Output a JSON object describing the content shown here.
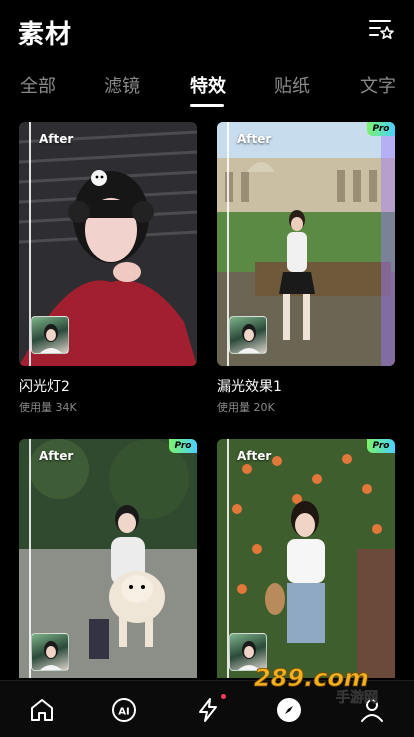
{
  "header": {
    "title": "素材"
  },
  "tabs": [
    {
      "label": "全部"
    },
    {
      "label": "滤镜"
    },
    {
      "label": "特效"
    },
    {
      "label": "贴纸"
    },
    {
      "label": "文字"
    }
  ],
  "active_tab_index": 2,
  "badges": {
    "after": "After",
    "pro": "Pro"
  },
  "cards": [
    {
      "name": "闪光灯2",
      "usage": "使用量 34K",
      "pro": false
    },
    {
      "name": "漏光效果1",
      "usage": "使用量 20K",
      "pro": true
    },
    {
      "name": "",
      "usage": "",
      "pro": true
    },
    {
      "name": "",
      "usage": "",
      "pro": true
    }
  ],
  "nav": {
    "items": [
      {
        "icon": "home-icon"
      },
      {
        "icon": "ai-icon",
        "label": "AI"
      },
      {
        "icon": "lightning-icon"
      },
      {
        "icon": "compass-icon"
      },
      {
        "icon": "profile-icon"
      }
    ]
  },
  "watermark": {
    "text": "289.com",
    "subtext": "手游网"
  },
  "colors": {
    "background": "#000000",
    "inactive_tab": "#8a8a8a",
    "pro_gradient_start": "#7cf36b",
    "pro_gradient_end": "#4ad1ff",
    "nav_dot": "#ff3b5c"
  }
}
